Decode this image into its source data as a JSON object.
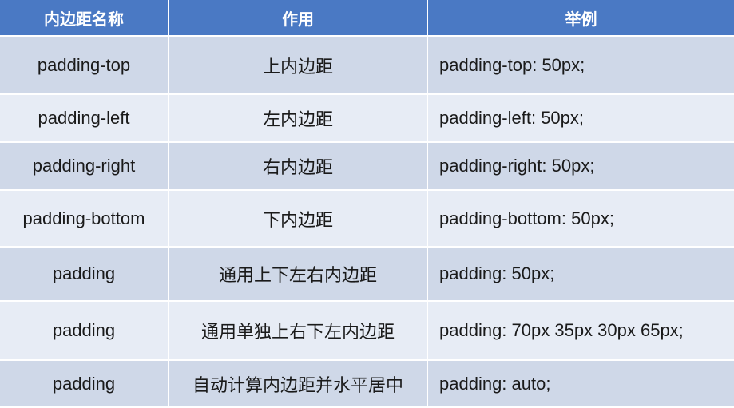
{
  "headers": {
    "name": "内边距名称",
    "use": "作用",
    "example": "举例"
  },
  "rows": [
    {
      "name": "padding-top",
      "use": "上内边距",
      "example": "padding-top: 50px;"
    },
    {
      "name": "padding-left",
      "use": "左内边距",
      "example": "padding-left: 50px;"
    },
    {
      "name": "padding-right",
      "use": "右内边距",
      "example": "padding-right: 50px;"
    },
    {
      "name": "padding-bottom",
      "use": "下内边距",
      "example": "padding-bottom: 50px;"
    },
    {
      "name": "padding",
      "use": "通用上下左右内边距",
      "example": "padding: 50px;"
    },
    {
      "name": "padding",
      "use": "通用单独上右下左内边距",
      "example": "padding: 70px 35px 30px 65px;"
    },
    {
      "name": "padding",
      "use": "自动计算内边距并水平居中",
      "example": "padding: auto;"
    }
  ]
}
